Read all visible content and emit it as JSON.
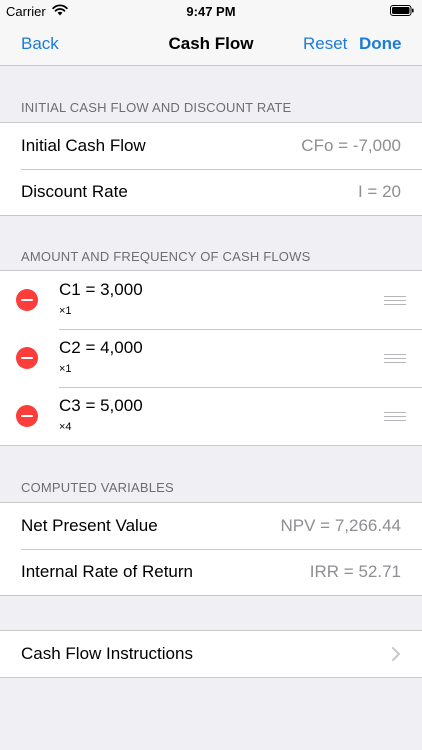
{
  "status": {
    "carrier": "Carrier",
    "time": "9:47 PM"
  },
  "nav": {
    "back": "Back",
    "title": "Cash Flow",
    "reset": "Reset",
    "done": "Done"
  },
  "initial": {
    "header": "INITIAL CASH FLOW AND DISCOUNT RATE",
    "rows": [
      {
        "label": "Initial Cash Flow",
        "value": "CFo = -7,000"
      },
      {
        "label": "Discount Rate",
        "value": "I = 20"
      }
    ]
  },
  "flows": {
    "header": "AMOUNT AND FREQUENCY OF CASH FLOWS",
    "items": [
      {
        "amount": "C1 = 3,000",
        "freq": "×1"
      },
      {
        "amount": "C2 = 4,000",
        "freq": "×1"
      },
      {
        "amount": "C3 = 5,000",
        "freq": "×4"
      }
    ]
  },
  "computed": {
    "header": "COMPUTED VARIABLES",
    "rows": [
      {
        "label": "Net Present Value",
        "value": "NPV = 7,266.44"
      },
      {
        "label": "Internal Rate of Return",
        "value": "IRR = 52.71"
      }
    ]
  },
  "instructions": {
    "label": "Cash Flow Instructions"
  },
  "icons": {
    "delete": "delete-icon",
    "reorder": "reorder-icon",
    "chevron": "chevron-right-icon",
    "wifi": "wifi-icon",
    "battery": "battery-icon"
  },
  "colors": {
    "accent": "#1c7bd8",
    "delete": "#fc3d39",
    "background": "#efeff4",
    "secondary_text": "#8e8e93"
  }
}
